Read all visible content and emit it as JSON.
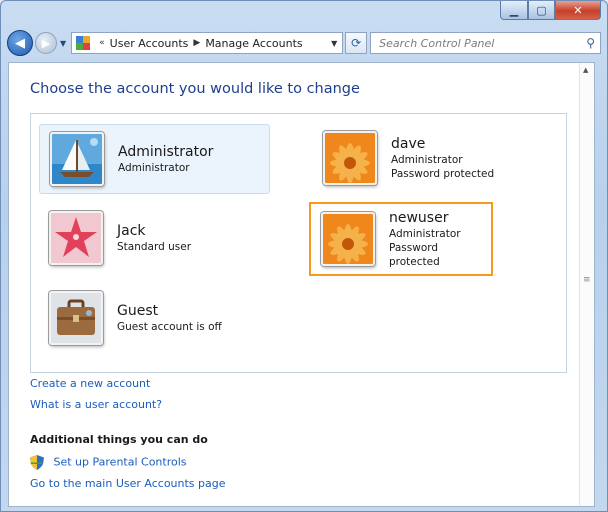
{
  "window": {
    "caption_buttons": [
      "minimize-icon",
      "maximize-icon",
      "close-icon"
    ]
  },
  "nav": {
    "back_icon": "back-arrow-icon",
    "forward_icon": "forward-arrow-icon",
    "breadcrumb": [
      "User Accounts",
      "Manage Accounts"
    ],
    "search_placeholder": "Search Control Panel"
  },
  "main": {
    "title": "Choose the account you would like to change",
    "accounts": [
      {
        "name": "Administrator",
        "lines": [
          "Administrator"
        ],
        "picture": "sailboat-picture",
        "selected": true
      },
      {
        "name": "dave",
        "lines": [
          "Administrator",
          "Password protected"
        ],
        "picture": "orange-flower-picture"
      },
      {
        "name": "Jack",
        "lines": [
          "Standard user"
        ],
        "picture": "pink-starfish-picture"
      },
      {
        "name": "newuser",
        "lines": [
          "Administrator",
          "Password protected"
        ],
        "picture": "orange-flower-picture",
        "highlighted": true
      },
      {
        "name": "Guest",
        "lines": [
          "Guest account is off"
        ],
        "picture": "briefcase-picture"
      }
    ],
    "links": [
      "Create a new account",
      "What is a user account?"
    ],
    "additional_heading": "Additional things you can do",
    "additional_links": [
      "Set up Parental Controls",
      "Go to the main User Accounts page"
    ]
  },
  "colors": {
    "title": "#1e3f90",
    "link": "#1a5dbf",
    "highlight_border": "#f59a1a",
    "selected_bg": "#ebf3fc"
  }
}
